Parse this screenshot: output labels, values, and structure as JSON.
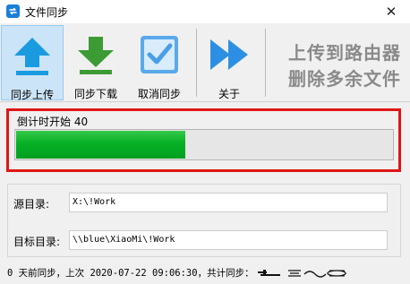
{
  "window": {
    "title": "文件同步",
    "icon": "sync-app-icon",
    "close_glyph": "✕"
  },
  "toolbar": {
    "upload_label": "同步上传",
    "download_label": "同步下载",
    "cancel_label": "取消同步",
    "about_label": "关于",
    "promo_line1": "上传到路由器",
    "promo_line2": "删除多余文件",
    "active_button": "upload",
    "icons": {
      "upload": "upload-arrow-icon",
      "download": "download-arrow-icon",
      "cancel": "checkbox-icon",
      "about": "fast-forward-icon"
    }
  },
  "countdown": {
    "label": "倒计时开始 40",
    "progress_percent": 45
  },
  "dirs": {
    "source_label": "源目录:",
    "source_value": "X:\\!Work",
    "target_label": "目标目录:",
    "target_value": "\\\\blue\\XiaoMi\\!Work"
  },
  "status": {
    "text": "0 天前同步，上次 2020-07-22 09:06:30，共计同步："
  },
  "colors": {
    "accent_blue": "#1a9be0",
    "green": "#3d9b35",
    "progress_green": "#06b025",
    "highlight_red": "#e01515"
  }
}
